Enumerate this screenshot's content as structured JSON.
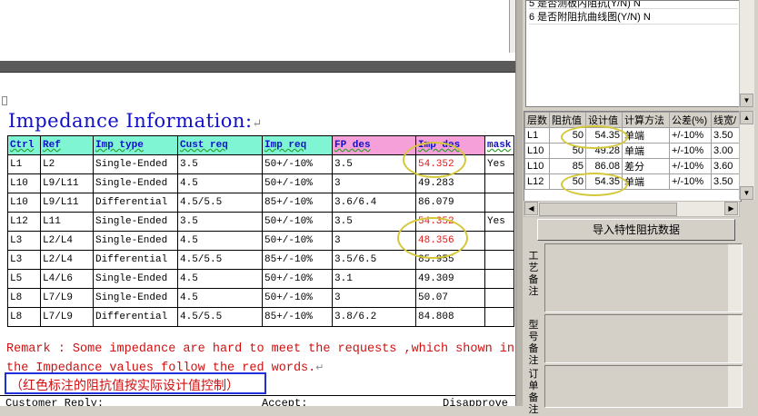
{
  "document": {
    "title": "Impedance Information:",
    "table": {
      "headers": [
        "Ctrl",
        "Ref",
        "Imp type",
        "Cust req",
        "Imp req",
        "FP des",
        "Imp des",
        "mask"
      ],
      "rows": [
        [
          "L1",
          "L2",
          "Single-Ended",
          "3.5",
          "50+/-10%",
          "3.5",
          "54.352",
          "Yes"
        ],
        [
          "L10",
          "L9/L11",
          "Single-Ended",
          "4.5",
          "50+/-10%",
          "3",
          "49.283",
          ""
        ],
        [
          "L10",
          "L9/L11",
          "Differential",
          "4.5/5.5",
          "85+/-10%",
          "3.6/6.4",
          "86.079",
          ""
        ],
        [
          "L12",
          "L11",
          "Single-Ended",
          "3.5",
          "50+/-10%",
          "3.5",
          "54.352",
          "Yes"
        ],
        [
          "L3",
          "L2/L4",
          "Single-Ended",
          "4.5",
          "50+/-10%",
          "3",
          "48.356",
          ""
        ],
        [
          "L3",
          "L2/L4",
          "Differential",
          "4.5/5.5",
          "85+/-10%",
          "3.5/6.5",
          "85.955",
          ""
        ],
        [
          "L5",
          "L4/L6",
          "Single-Ended",
          "4.5",
          "50+/-10%",
          "3.1",
          "49.309",
          ""
        ],
        [
          "L8",
          "L7/L9",
          "Single-Ended",
          "4.5",
          "50+/-10%",
          "3",
          "50.07",
          ""
        ],
        [
          "L8",
          "L7/L9",
          "Differential",
          "4.5/5.5",
          "85+/-10%",
          "3.8/6.2",
          "84.808",
          ""
        ]
      ]
    },
    "remark": "Remark : Some impedance are hard to meet the requests ,which shown in the Impedance values follow the red words.",
    "note_cn": "（红色标注的阻抗值按实际设计值控制）",
    "footer": {
      "customer": "Customer Reply:",
      "accept": "Accept:",
      "disapprove": "Disapprove"
    }
  },
  "right_panel": {
    "top_list": {
      "items": [
        "5 是否测板内阻抗(Y/N) N",
        "6 是否附阻抗曲线图(Y/N) N"
      ]
    },
    "grid": {
      "headers": [
        "层数",
        "阻抗值",
        "设计值",
        "计算方法",
        "公差(%)",
        "线宽/"
      ],
      "rows": [
        [
          "L1",
          "50",
          "54.35",
          "单端",
          "+/-10%",
          "3.50"
        ],
        [
          "L10",
          "50",
          "49.28",
          "单端",
          "+/-10%",
          "3.00"
        ],
        [
          "L10",
          "85",
          "86.08",
          "差分",
          "+/-10%",
          "3.60"
        ],
        [
          "L12",
          "50",
          "54.35",
          "单端",
          "+/-10%",
          "3.50"
        ]
      ]
    },
    "import_button": "导入特性阻抗数据",
    "notes": {
      "process_label": "工艺备注",
      "model_label": "型号备注",
      "order_label": "订单备注"
    }
  },
  "colors": {
    "title_blue": "#1010c8",
    "highlight_red": "#e01818",
    "header_cyan": "#7ff5d4",
    "header_pink": "#f5a0d8",
    "annotation_blue_box": "#2030d8",
    "annotation_yellow_ellipse": "#d4c83a"
  }
}
